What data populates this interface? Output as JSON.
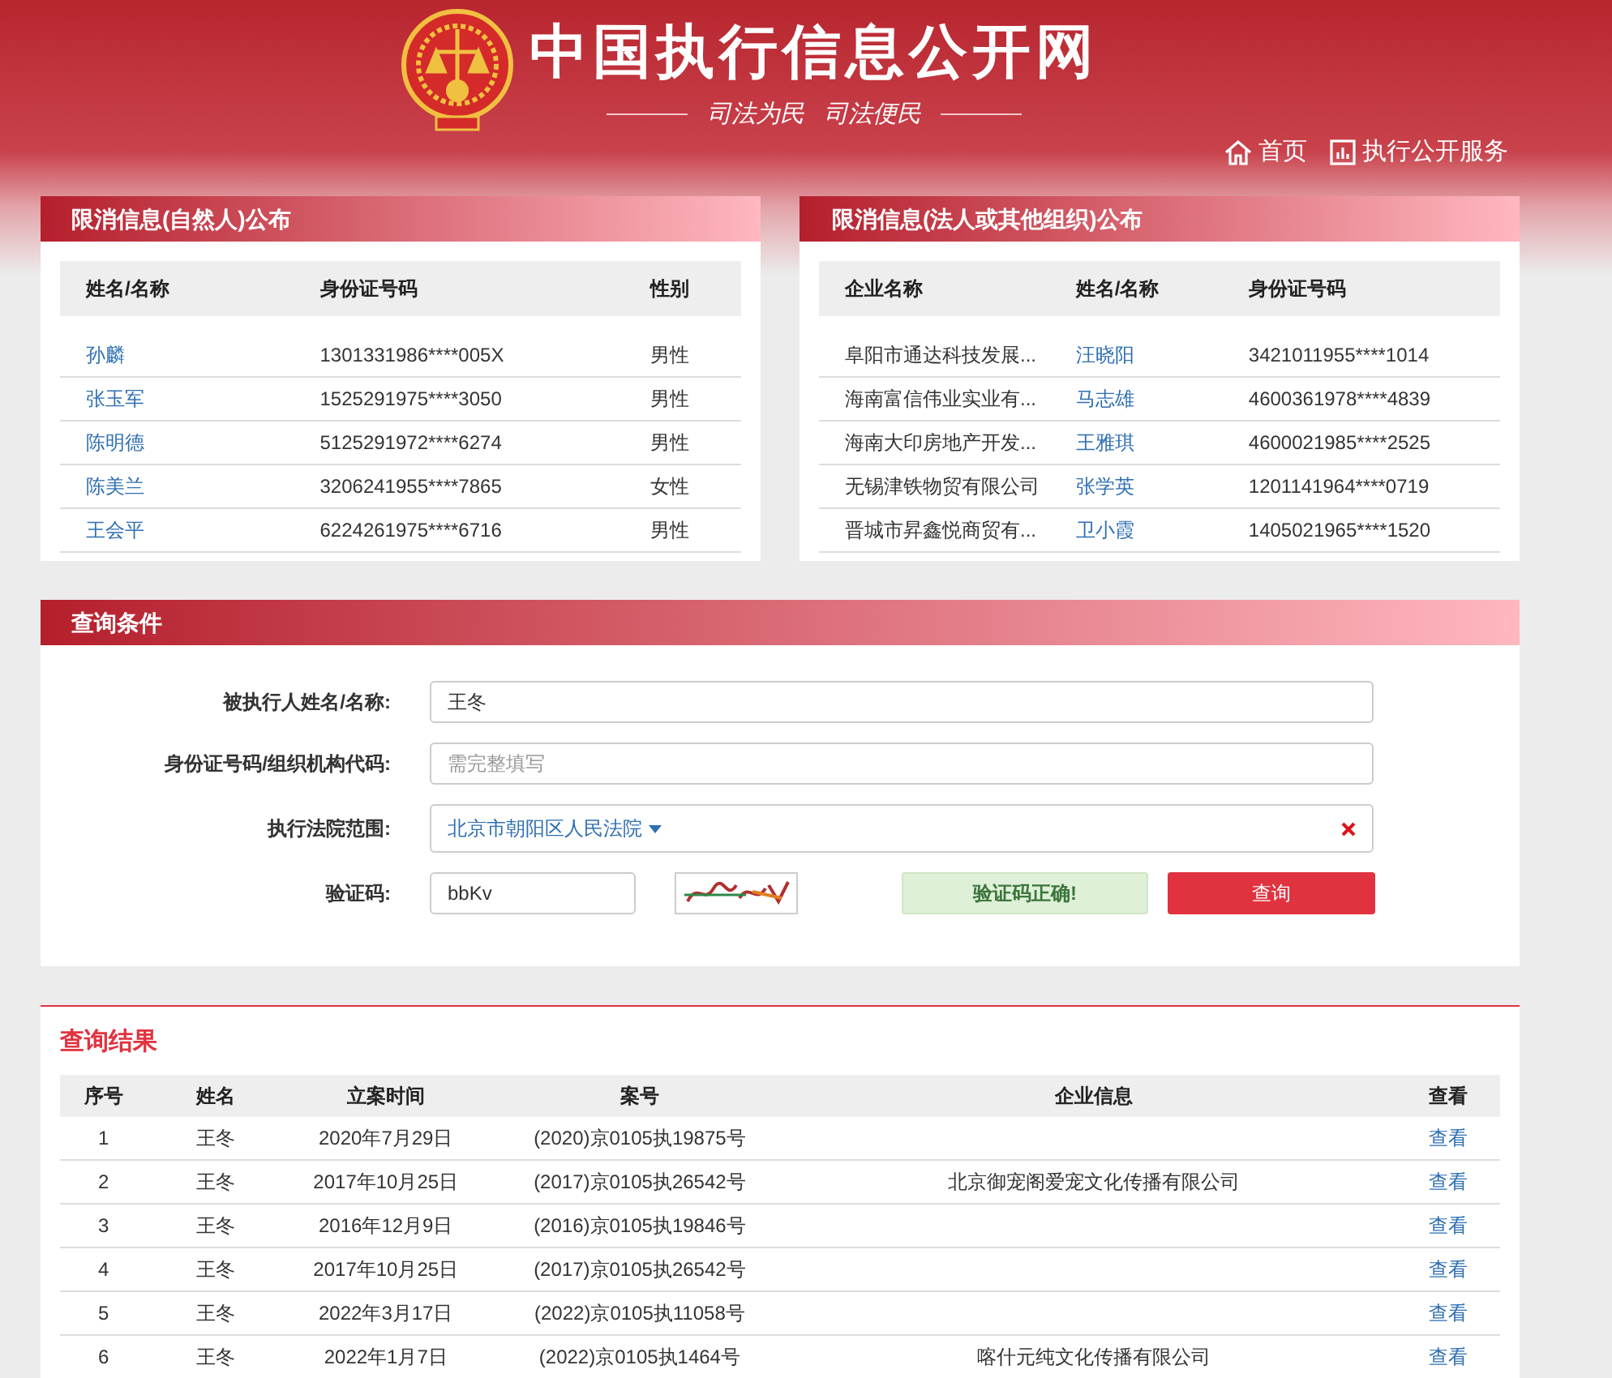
{
  "header": {
    "site_title": "中国执行信息公开网",
    "slogan": [
      "司法为民",
      "司法便民"
    ],
    "nav": [
      {
        "kind": "home",
        "label": "首页"
      },
      {
        "kind": "chart",
        "label": "执行公开服务"
      }
    ]
  },
  "person_panel": {
    "title": "限消信息(自然人)公布",
    "columns": [
      "姓名/名称",
      "身份证号码",
      "性别"
    ],
    "rows": [
      {
        "name": "孙麟",
        "id_number": "1301331986****005X",
        "gender": "男性"
      },
      {
        "name": "张玉军",
        "id_number": "1525291975****3050",
        "gender": "男性"
      },
      {
        "name": "陈明德",
        "id_number": "5125291972****6274",
        "gender": "男性"
      },
      {
        "name": "陈美兰",
        "id_number": "3206241955****7865",
        "gender": "女性"
      },
      {
        "name": "王会平",
        "id_number": "6224261975****6716",
        "gender": "男性"
      }
    ]
  },
  "org_panel": {
    "title": "限消信息(法人或其他组织)公布",
    "columns": [
      "企业名称",
      "姓名/名称",
      "身份证号码"
    ],
    "rows": [
      {
        "company": "阜阳市通达科技发展...",
        "name": "汪晓阳",
        "id_number": "3421011955****1014"
      },
      {
        "company": "海南富信伟业实业有...",
        "name": "马志雄",
        "id_number": "4600361978****4839"
      },
      {
        "company": "海南大印房地产开发...",
        "name": "王雅琪",
        "id_number": "4600021985****2525"
      },
      {
        "company": "无锡津铁物贸有限公司",
        "name": "张学英",
        "id_number": "1201141964****0719"
      },
      {
        "company": "晋城市昇鑫悦商贸有...",
        "name": "卫小霞",
        "id_number": "1405021965****1520"
      }
    ]
  },
  "query": {
    "title": "查询条件",
    "fields": [
      {
        "kind": "text",
        "label": "被执行人姓名/名称:",
        "value": "王冬"
      },
      {
        "kind": "text",
        "label": "身份证号码/组织机构代码:",
        "placeholder": "需完整填写"
      },
      {
        "kind": "select",
        "label": "执行法院范围:",
        "value": "北京市朝阳区人民法院"
      }
    ],
    "captcha": {
      "label": "验证码:",
      "value": "bbKv",
      "status": "验证码正确!",
      "button": "查询"
    }
  },
  "results": {
    "title": "查询结果",
    "columns": [
      "序号",
      "姓名",
      "立案时间",
      "案号",
      "企业信息",
      "查看"
    ],
    "rows": [
      {
        "index": "1",
        "name": "王冬",
        "date": "2020年7月29日",
        "case_no": "(2020)京0105执19875号",
        "company": "",
        "link": "查看"
      },
      {
        "index": "2",
        "name": "王冬",
        "date": "2017年10月25日",
        "case_no": "(2017)京0105执26542号",
        "company": "北京御宠阁爱宠文化传播有限公司",
        "link": "查看"
      },
      {
        "index": "3",
        "name": "王冬",
        "date": "2016年12月9日",
        "case_no": "(2016)京0105执19846号",
        "company": "",
        "link": "查看"
      },
      {
        "index": "4",
        "name": "王冬",
        "date": "2017年10月25日",
        "case_no": "(2017)京0105执26542号",
        "company": "",
        "link": "查看"
      },
      {
        "index": "5",
        "name": "王冬",
        "date": "2022年3月17日",
        "case_no": "(2022)京0105执11058号",
        "company": "",
        "link": "查看"
      },
      {
        "index": "6",
        "name": "王冬",
        "date": "2022年1月7日",
        "case_no": "(2022)京0105执1464号",
        "company": "喀什元纯文化传播有限公司",
        "link": "查看"
      }
    ]
  }
}
